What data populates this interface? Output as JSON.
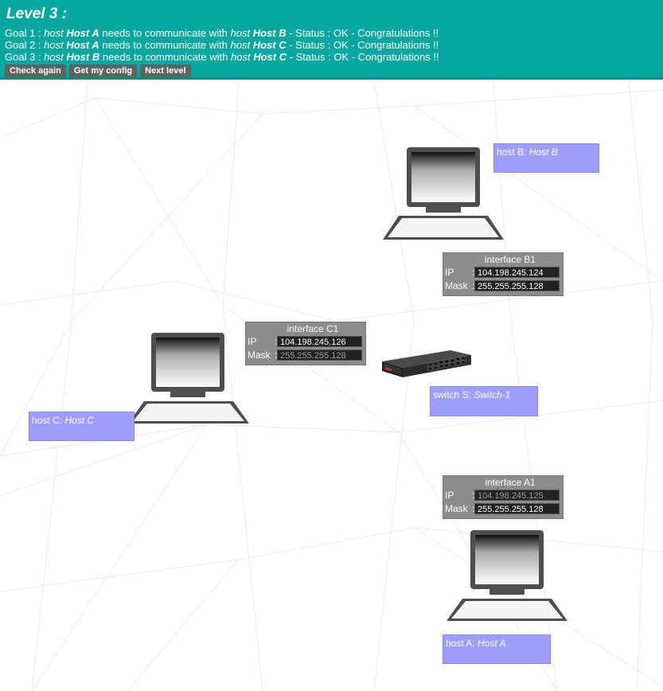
{
  "header": {
    "level_title": "Level 3 :",
    "goals": [
      {
        "prefix": "Goal 1 : ",
        "w1": "host",
        "h1": "Host A",
        "mid": " needs to communicate with ",
        "w2": "host",
        "h2": "Host B",
        "status": " - Status : OK - Congratulations !!"
      },
      {
        "prefix": "Goal 2 : ",
        "w1": "host",
        "h1": "Host A",
        "mid": " needs to communicate with ",
        "w2": "host",
        "h2": "Host C",
        "status": " - Status : OK - Congratulations !!"
      },
      {
        "prefix": "Goal 3 : ",
        "w1": "host",
        "h1": "Host B",
        "mid": " needs to communicate with ",
        "w2": "host",
        "h2": "Host C",
        "status": " - Status : OK - Congratulations !!"
      }
    ],
    "buttons": {
      "check": "Check again",
      "config": "Get my config",
      "next": "Next level"
    }
  },
  "hosts": {
    "b": {
      "type": "host B: ",
      "name": "Host B"
    },
    "c": {
      "type": "host C: ",
      "name": "Host C"
    },
    "a": {
      "type": "host A: ",
      "name": "Host A"
    }
  },
  "switch": {
    "type": "switch S: ",
    "name": "Switch-1"
  },
  "interfaces": {
    "b1": {
      "title": "interface B1",
      "ip_label": "IP",
      "mask_label": "Mask",
      "colon": ":",
      "ip": "104.198.245.124",
      "mask": "255.255.255.128"
    },
    "c1": {
      "title": "interface C1",
      "ip_label": "IP",
      "mask_label": "Mask",
      "colon": ":",
      "ip": "104.198.245.126",
      "mask": "255.255.255.128"
    },
    "a1": {
      "title": "interface A1",
      "ip_label": "IP",
      "mask_label": "Mask",
      "colon": ":",
      "ip": "104.198.245.125",
      "mask": "255.255.255.128"
    }
  },
  "colors": {
    "header_bg": "#07a7a1",
    "label_bg": "#9d9dfc",
    "iface_bg": "#8c8c8c"
  },
  "icons": [
    "computer-icon",
    "network-switch-icon"
  ]
}
